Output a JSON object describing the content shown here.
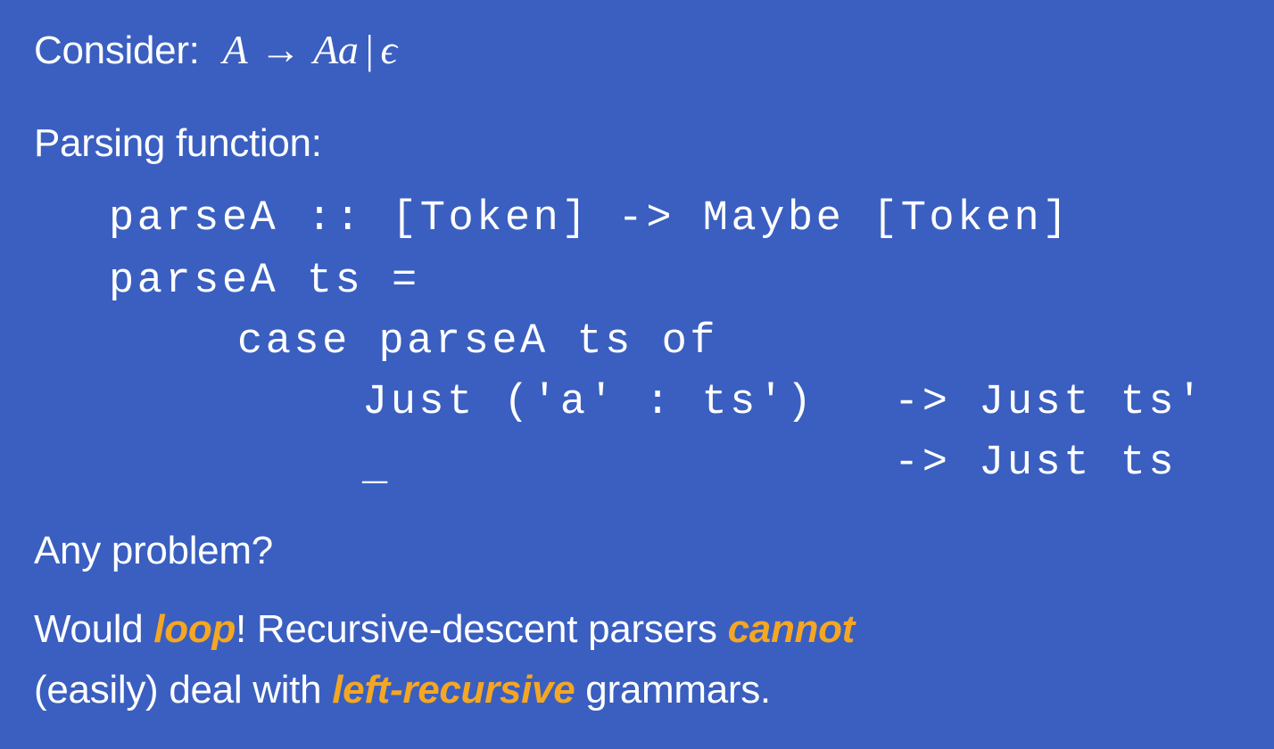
{
  "consider": {
    "label": "Consider:",
    "lhs": "A",
    "arrow": "→",
    "rhs": "Aa",
    "bar": "|",
    "epsilon": "ϵ"
  },
  "parsing_function_label": "Parsing function:",
  "code": {
    "line1": "parseA :: [Token] -> Maybe [Token]",
    "line2": "parseA ts =",
    "line3": "case parseA ts of",
    "line4_pattern": "Just ('a' : ts')",
    "line4_result": "-> Just ts'",
    "line5_pattern": "_",
    "line5_result": "-> Just ts"
  },
  "question": "Any problem?",
  "answer": {
    "part1": "Would ",
    "loop": "loop",
    "part2": "! Recursive-descent parsers ",
    "cannot": "cannot",
    "part3": "(easily) deal with ",
    "left_recursive": "left-recursive",
    "part4": " grammars."
  },
  "colors": {
    "background": "#3a5fc0",
    "text": "#ffffff",
    "emphasis": "#f5a623"
  }
}
